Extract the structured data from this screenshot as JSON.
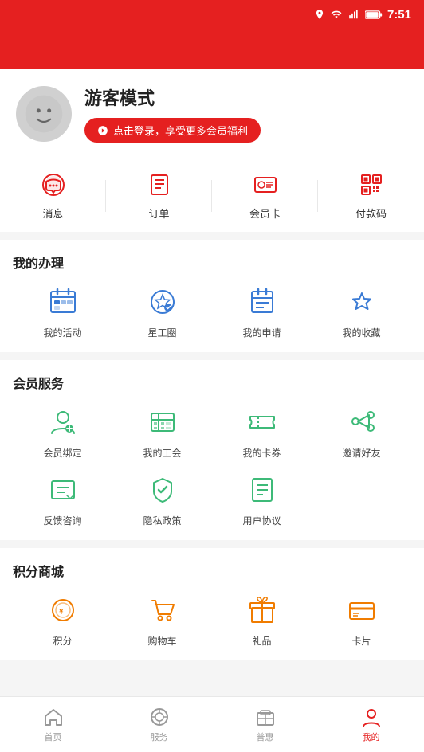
{
  "statusBar": {
    "time": "7:51"
  },
  "profile": {
    "name": "游客模式",
    "loginBtn": "点击登录，享受更多会员福利"
  },
  "quickActions": [
    {
      "label": "消息",
      "icon": "message"
    },
    {
      "label": "订单",
      "icon": "order"
    },
    {
      "label": "会员卡",
      "icon": "membercard"
    },
    {
      "label": "付款码",
      "icon": "qrcode"
    }
  ],
  "mySection": {
    "title": "我的办理",
    "items": [
      {
        "label": "我的活动",
        "icon": "activity",
        "color": "blue"
      },
      {
        "label": "星工圈",
        "icon": "star-circle",
        "color": "blue"
      },
      {
        "label": "我的申请",
        "icon": "calendar",
        "color": "blue"
      },
      {
        "label": "我的收藏",
        "icon": "star",
        "color": "blue"
      }
    ]
  },
  "memberSection": {
    "title": "会员服务",
    "row1": [
      {
        "label": "会员绑定",
        "icon": "user-bind",
        "color": "green"
      },
      {
        "label": "我的工会",
        "icon": "union",
        "color": "green"
      },
      {
        "label": "我的卡券",
        "icon": "coupon",
        "color": "green"
      },
      {
        "label": "邀请好友",
        "icon": "invite",
        "color": "green"
      }
    ],
    "row2": [
      {
        "label": "反馈咨询",
        "icon": "feedback",
        "color": "green"
      },
      {
        "label": "隐私政策",
        "icon": "privacy",
        "color": "green"
      },
      {
        "label": "用户协议",
        "icon": "agreement",
        "color": "green"
      }
    ]
  },
  "pointsSection": {
    "title": "积分商城",
    "items": [
      {
        "label": "积分",
        "icon": "points",
        "color": "orange"
      },
      {
        "label": "购物车",
        "icon": "cart",
        "color": "orange"
      },
      {
        "label": "礼品",
        "icon": "gift",
        "color": "orange"
      },
      {
        "label": "卡片",
        "icon": "card",
        "color": "orange"
      }
    ]
  },
  "bottomNav": [
    {
      "label": "首页",
      "icon": "home",
      "active": false
    },
    {
      "label": "服务",
      "icon": "service",
      "active": false
    },
    {
      "label": "普惠",
      "icon": "benefits",
      "active": false
    },
    {
      "label": "我的",
      "icon": "profile",
      "active": true
    }
  ]
}
